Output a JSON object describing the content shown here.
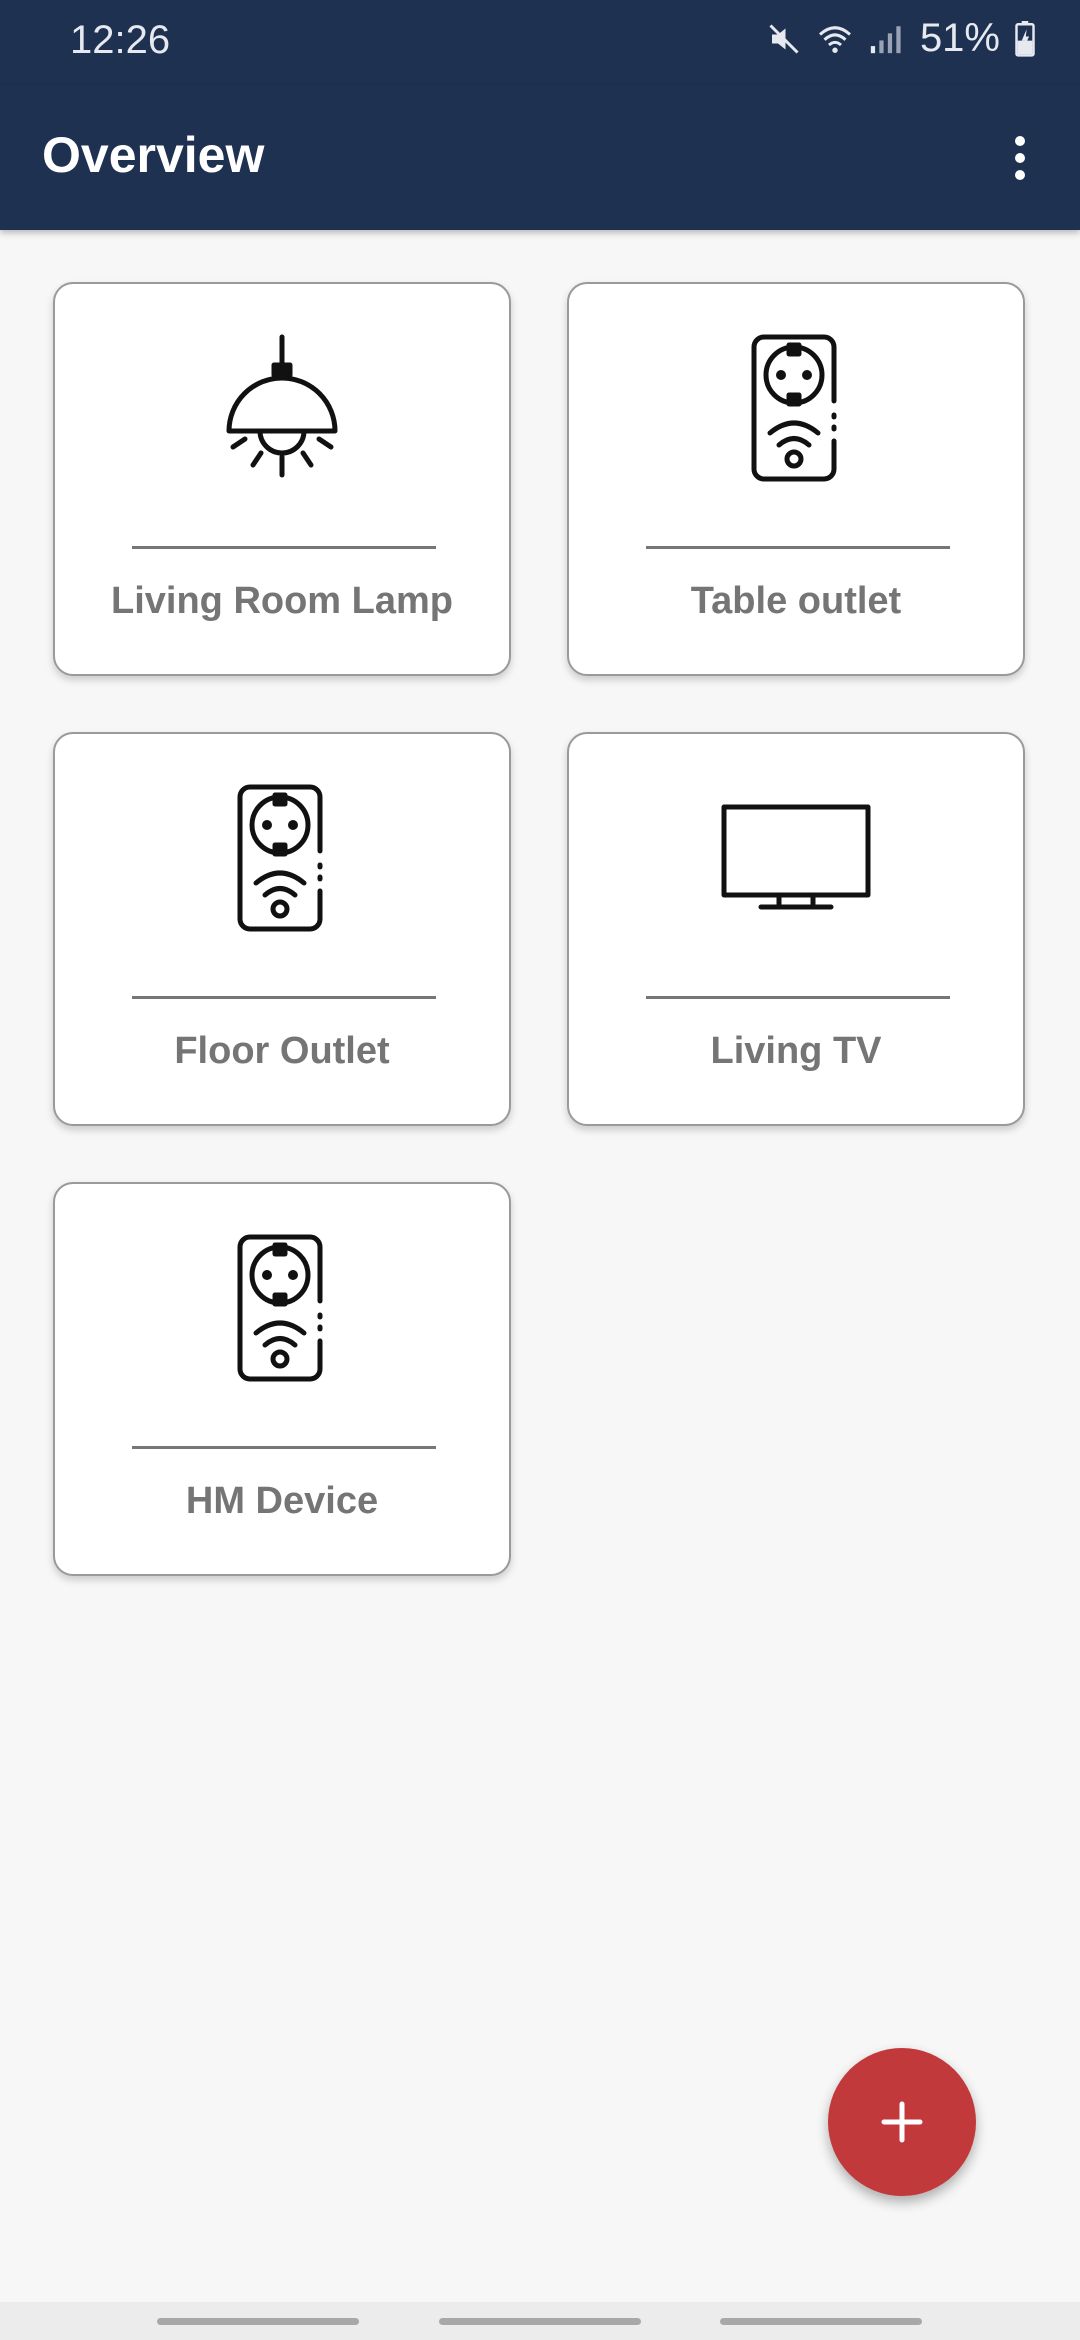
{
  "status_bar": {
    "time": "12:26",
    "battery": "51%",
    "icons": [
      "mute-icon",
      "wifi-icon",
      "signal-icon",
      "battery-charging-icon"
    ]
  },
  "app_bar": {
    "title": "Overview",
    "menu_icon": "more-vert-icon",
    "color": "#1f3150"
  },
  "devices": [
    {
      "name": "Living Room Lamp",
      "icon": "ceiling-lamp-icon"
    },
    {
      "name": "Table outlet",
      "icon": "smart-plug-icon"
    },
    {
      "name": "Floor Outlet",
      "icon": "smart-plug-icon"
    },
    {
      "name": "Living TV",
      "icon": "tv-icon"
    },
    {
      "name": "HM Device",
      "icon": "smart-plug-icon"
    }
  ],
  "fab": {
    "icon": "plus-icon",
    "color": "#c2393c"
  }
}
